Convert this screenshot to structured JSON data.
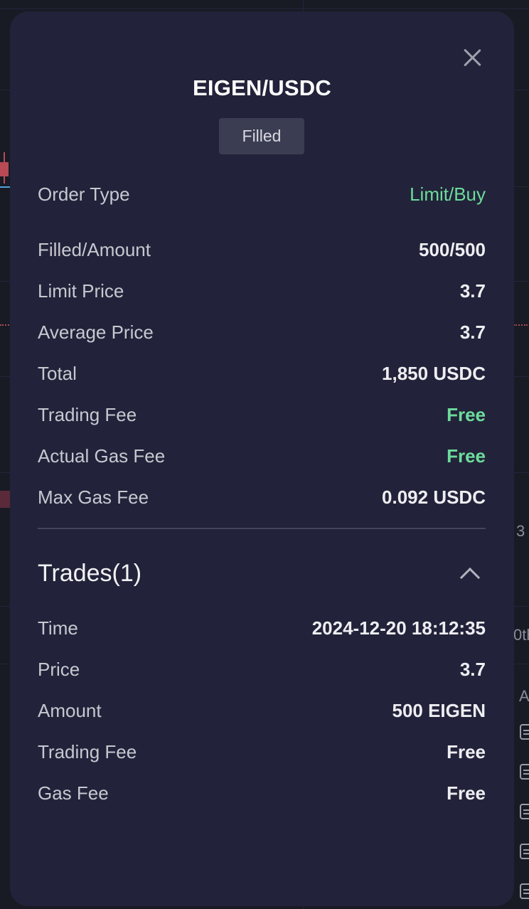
{
  "modal": {
    "title": "EIGEN/USDC",
    "status_badge": "Filled",
    "details": [
      {
        "label": "Order Type",
        "value": "Limit/Buy"
      },
      {
        "label": "Filled/Amount",
        "value": "500/500"
      },
      {
        "label": "Limit Price",
        "value": "3.7"
      },
      {
        "label": "Average Price",
        "value": "3.7"
      },
      {
        "label": "Total",
        "value": "1,850 USDC"
      },
      {
        "label": "Trading Fee",
        "value": "Free"
      },
      {
        "label": "Actual Gas Fee",
        "value": "Free"
      },
      {
        "label": "Max Gas Fee",
        "value": "0.092 USDC"
      }
    ],
    "trades": {
      "title": "Trades(1)",
      "rows": [
        {
          "label": "Time",
          "value": "2024-12-20 18:12:35"
        },
        {
          "label": "Price",
          "value": "3.7"
        },
        {
          "label": "Amount",
          "value": "500 EIGEN"
        },
        {
          "label": "Trading Fee",
          "value": "Free"
        },
        {
          "label": "Gas Fee",
          "value": "Free"
        }
      ]
    },
    "icons": {
      "close": "close-icon",
      "collapse": "chevron-up-icon"
    },
    "colors": {
      "accent_green": "#6ddc9b",
      "modal_bg": "#22233a",
      "badge_bg": "#3b3d52"
    }
  },
  "background_peek": {
    "text_1": "3",
    "text_2": "0th",
    "text_3": "A"
  }
}
